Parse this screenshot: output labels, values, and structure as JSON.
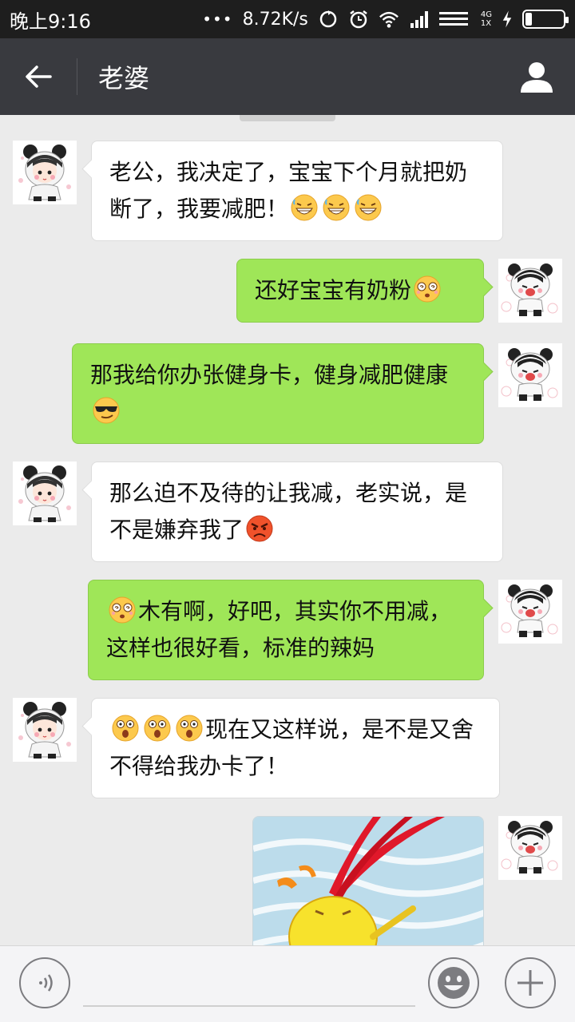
{
  "status_bar": {
    "time": "晚上9:16",
    "dots": "•••",
    "network_speed": "8.72K/s",
    "network_type": "4G",
    "sim": "1X"
  },
  "header": {
    "title": "老婆"
  },
  "messages": [
    {
      "side": "in",
      "text": "老公，我决定了，宝宝下个月就把奶断了，我要减肥！",
      "emojis": [
        "grin-sweat",
        "grin-sweat",
        "grin-sweat"
      ]
    },
    {
      "side": "out",
      "text": "还好宝宝有奶粉",
      "emojis": [
        "dizzy"
      ]
    },
    {
      "side": "out",
      "text": "那我给你办张健身卡，健身减肥健康",
      "emojis": [
        "cool"
      ]
    },
    {
      "side": "in",
      "text": "那么迫不及待的让我减，老实说，是不是嫌弃我了",
      "emojis": [
        "angry"
      ]
    },
    {
      "side": "out",
      "text": "木有啊，好吧，其实你不用减，这样也很好看，标准的辣妈",
      "emojis": [
        "dizzy"
      ]
    },
    {
      "side": "in",
      "text": "现在又这样说，是不是又舍不得给我办卡了！",
      "emojis": [
        "shocked",
        "shocked",
        "shocked"
      ]
    },
    {
      "side": "out",
      "type": "image",
      "description_icon": "yellow-chick-sticker"
    }
  ],
  "colors": {
    "nav": "#393a3f",
    "status": "#1e1e1e",
    "bubble_out": "#9fe658",
    "bubble_in": "#ffffff",
    "chat_bg": "#ebebeb"
  },
  "input": {
    "value": ""
  }
}
